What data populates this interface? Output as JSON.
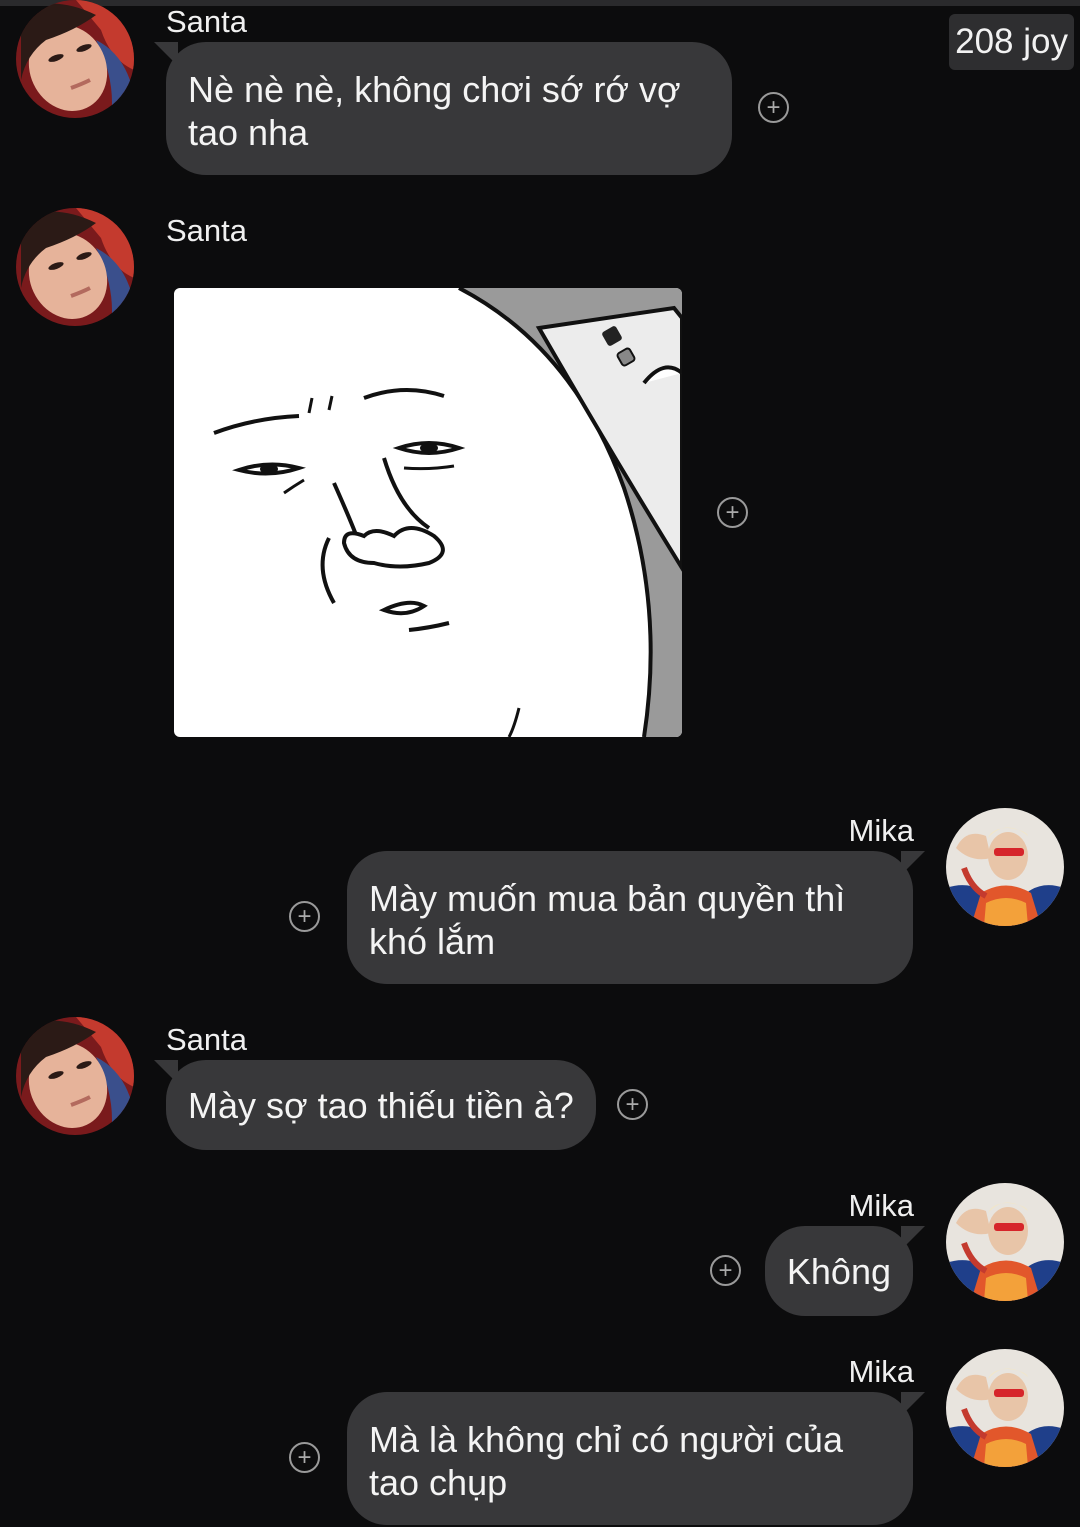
{
  "header": {
    "points_badge": "208 joy"
  },
  "messages": [
    {
      "sender": "Santa",
      "type": "text",
      "text": "Nè nè nè, không chơi sớ rớ vợ tao nha"
    },
    {
      "sender": "Santa",
      "type": "sticker",
      "description": "cartoon face sticker"
    },
    {
      "sender": "Mika",
      "type": "text",
      "text": "Mày muốn mua bản quyền thì khó lắm"
    },
    {
      "sender": "Santa",
      "type": "text",
      "text": "Mày sợ tao thiếu tiền à?"
    },
    {
      "sender": "Mika",
      "type": "text",
      "text": "Không"
    },
    {
      "sender": "Mika",
      "type": "text",
      "text": "Mà là không chỉ có người của tao chụp"
    }
  ],
  "icons": {
    "react": "plus-circle-icon",
    "avatar_santa": "avatar-santa",
    "avatar_mika": "avatar-mika"
  },
  "colors": {
    "background": "#0c0c0d",
    "bubble": "#38383a",
    "text": "#f4f4f4"
  }
}
